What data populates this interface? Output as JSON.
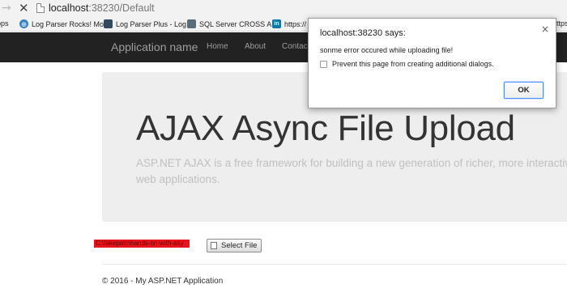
{
  "browser": {
    "url_host": "localhost",
    "url_path": ":38230/Default",
    "bookmarks": [
      {
        "label": "pps",
        "icon": "apps-icon"
      },
      {
        "label": "Log Parser Rocks! Mo",
        "icon": "globe-icon"
      },
      {
        "label": "Log Parser Plus - Log",
        "icon": "app-icon"
      },
      {
        "label": "SQL Server CROSS AP",
        "icon": "sql-icon"
      },
      {
        "label": "https://",
        "icon": "linkedin-icon"
      },
      {
        "label": "https",
        "icon": "link-icon"
      }
    ]
  },
  "navbar": {
    "brand": "Application name",
    "links": [
      "Home",
      "About",
      "Contac"
    ]
  },
  "jumbotron": {
    "title": "AJAX Async File Upload",
    "lead": "ASP.NET AJAX is a free framework for building a new generation of richer, more interactive, h web applications."
  },
  "upload": {
    "file_path": "C:\\fakepath\\hands-on-with-asy",
    "button_label": "Select File"
  },
  "footer": {
    "text": "© 2016 - My ASP.NET Application"
  },
  "dialog": {
    "title": "localhost:38230 says:",
    "message": "sonme error occured while uploading file!",
    "checkbox_label": "Prevent this page from creating additional dialogs.",
    "ok_label": "OK"
  }
}
